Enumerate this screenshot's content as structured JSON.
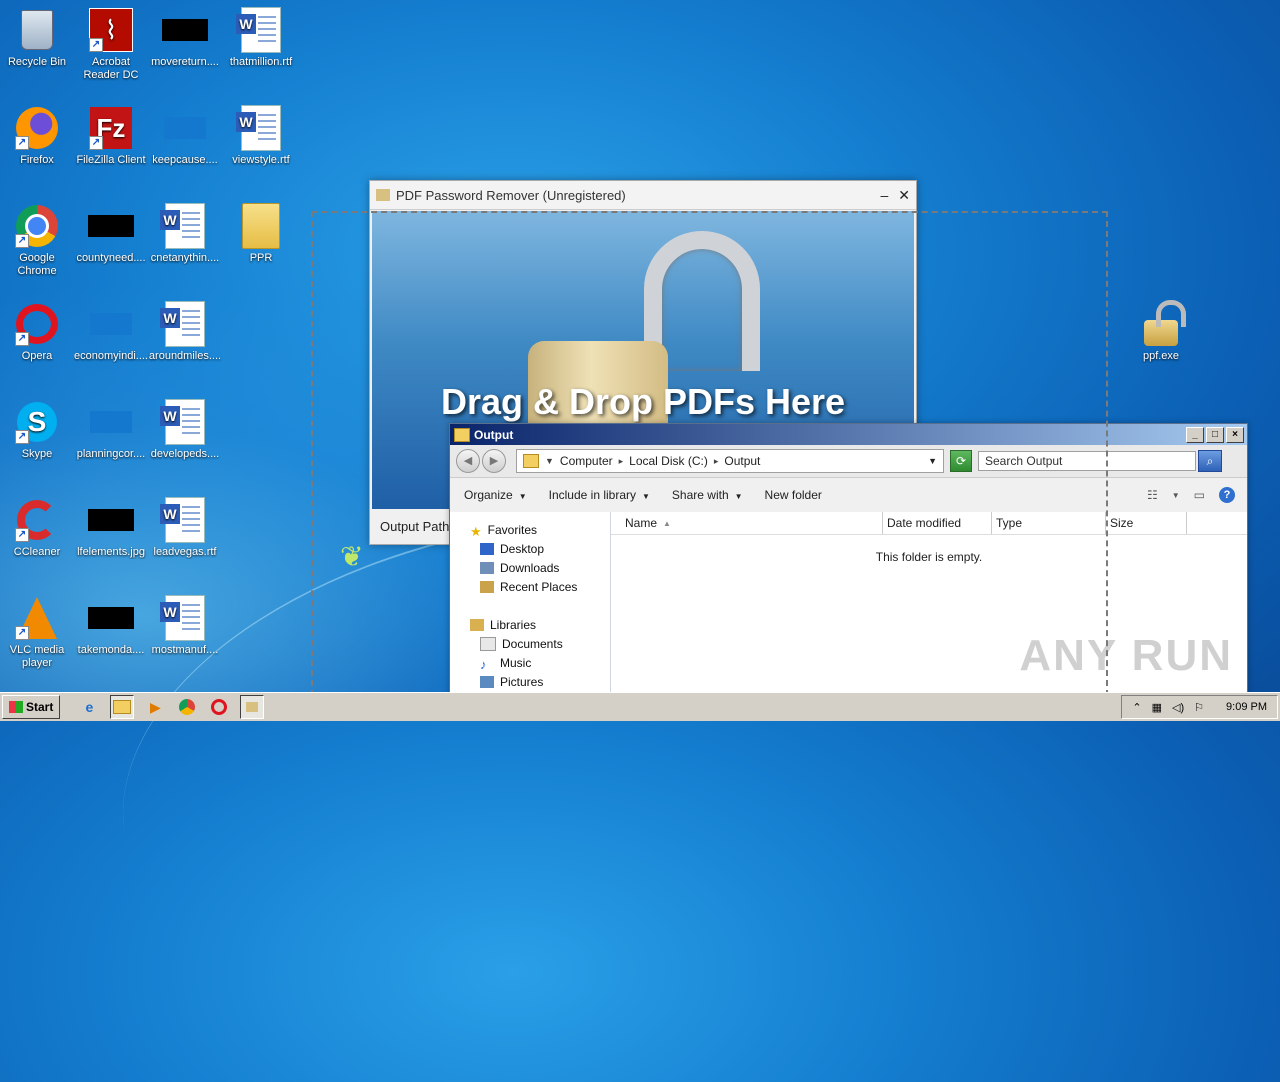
{
  "desktop": {
    "icons": [
      {
        "label": "Recycle Bin",
        "icon": "recycle-bin-icon"
      },
      {
        "label": "Acrobat Reader DC",
        "icon": "acrobat-icon"
      },
      {
        "label": "movereturn....",
        "icon": "black-thumbnail-icon"
      },
      {
        "label": "thatmillion.rtf",
        "icon": "word-document-icon"
      },
      {
        "label": "Firefox",
        "icon": "firefox-icon"
      },
      {
        "label": "FileZilla Client",
        "icon": "filezilla-icon"
      },
      {
        "label": "keepcause....",
        "icon": "blue-thumbnail-icon"
      },
      {
        "label": "viewstyle.rtf",
        "icon": "word-document-icon"
      },
      {
        "label": "Google Chrome",
        "icon": "chrome-icon"
      },
      {
        "label": "countyneed....",
        "icon": "black-thumbnail-icon"
      },
      {
        "label": "cnetanythin....",
        "icon": "word-document-icon"
      },
      {
        "label": "PPR",
        "icon": "folder-icon"
      },
      {
        "label": "Opera",
        "icon": "opera-icon"
      },
      {
        "label": "economyindi....",
        "icon": "blue-thumbnail-icon"
      },
      {
        "label": "aroundmiles....",
        "icon": "word-document-icon"
      },
      {
        "label": "Skype",
        "icon": "skype-icon"
      },
      {
        "label": "planningcor....",
        "icon": "blue-thumbnail-icon"
      },
      {
        "label": "developeds....",
        "icon": "word-document-icon"
      },
      {
        "label": "CCleaner",
        "icon": "ccleaner-icon"
      },
      {
        "label": "lfelements.jpg",
        "icon": "black-thumbnail-icon"
      },
      {
        "label": "leadvegas.rtf",
        "icon": "word-document-icon"
      },
      {
        "label": "VLC media player",
        "icon": "vlc-icon"
      },
      {
        "label": "takemonda....",
        "icon": "black-thumbnail-icon"
      },
      {
        "label": "mostmanuf....",
        "icon": "word-document-icon"
      },
      {
        "label": "ppf.exe",
        "icon": "padlock-icon"
      }
    ]
  },
  "pdf_window": {
    "title": "PDF Password Remover (Unregistered)",
    "minimize": "–",
    "close": "✕",
    "drop_text": "Drag & Drop PDFs Here",
    "output_label": "Output Path"
  },
  "explorer": {
    "title": "Output",
    "breadcrumb": [
      "Computer",
      "Local Disk (C:)",
      "Output"
    ],
    "search_placeholder": "Search Output",
    "toolbar": {
      "organize": "Organize",
      "include": "Include in library",
      "share": "Share with",
      "new_folder": "New folder"
    },
    "nav": {
      "favorites": "Favorites",
      "desktop": "Desktop",
      "downloads": "Downloads",
      "recent": "Recent Places",
      "libraries": "Libraries",
      "documents": "Documents",
      "music": "Music",
      "pictures": "Pictures"
    },
    "columns": [
      "Name",
      "Date modified",
      "Type",
      "Size"
    ],
    "empty_message": "This folder is empty.",
    "watermark": "ANY RUN"
  },
  "taskbar": {
    "start": "Start",
    "time": "9:09 PM"
  }
}
